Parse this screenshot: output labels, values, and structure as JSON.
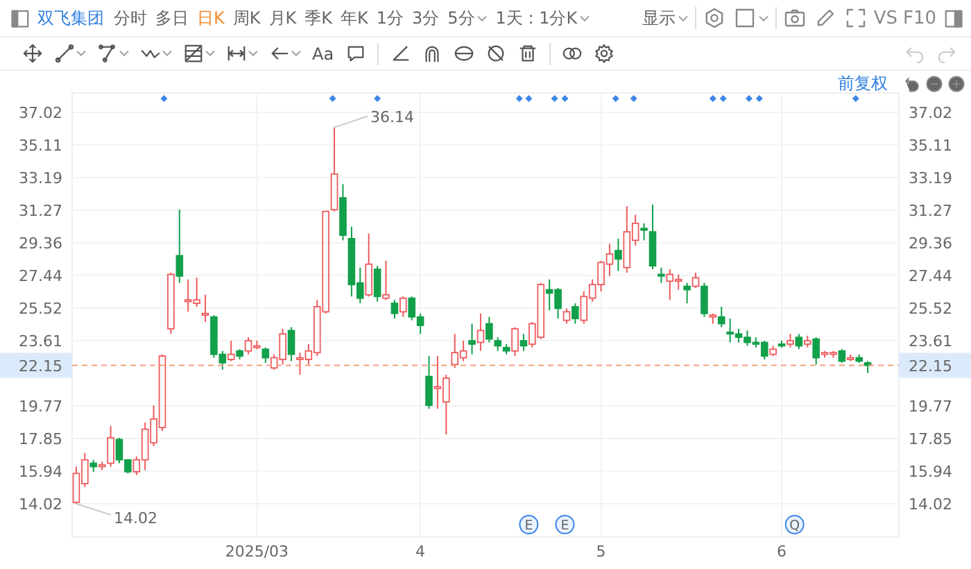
{
  "toolbar": {
    "stock_name": "双飞集团",
    "periods": [
      {
        "label": "分时",
        "selected": false,
        "dropdown": false
      },
      {
        "label": "多日",
        "selected": false,
        "dropdown": false
      },
      {
        "label": "日K",
        "selected": true,
        "dropdown": false
      },
      {
        "label": "周K",
        "selected": false,
        "dropdown": false
      },
      {
        "label": "月K",
        "selected": false,
        "dropdown": false
      },
      {
        "label": "季K",
        "selected": false,
        "dropdown": false
      },
      {
        "label": "年K",
        "selected": false,
        "dropdown": false
      },
      {
        "label": "1分",
        "selected": false,
        "dropdown": false
      },
      {
        "label": "3分",
        "selected": false,
        "dropdown": false
      },
      {
        "label": "5分",
        "selected": false,
        "dropdown": true
      }
    ],
    "interval_select": "1天 : 1分K",
    "display_menu": "显示",
    "compare": "VS",
    "f10": "F10"
  },
  "drawing_tools": [
    {
      "kind": "move",
      "dropdown": false
    },
    {
      "kind": "line",
      "dropdown": true
    },
    {
      "kind": "polyline",
      "dropdown": true
    },
    {
      "kind": "wave",
      "dropdown": true
    },
    {
      "kind": "fib",
      "dropdown": true
    },
    {
      "kind": "measure",
      "dropdown": true
    },
    {
      "kind": "arrow",
      "dropdown": true
    },
    {
      "kind": "text",
      "label": "Aa",
      "dropdown": false
    },
    {
      "kind": "comment",
      "dropdown": false
    },
    {
      "kind": "separator"
    },
    {
      "kind": "angle",
      "dropdown": false
    },
    {
      "kind": "magnet",
      "dropdown": false
    },
    {
      "kind": "eye",
      "dropdown": false
    },
    {
      "kind": "eye_off",
      "dropdown": false
    },
    {
      "kind": "trash",
      "dropdown": false
    },
    {
      "kind": "separator"
    },
    {
      "kind": "link",
      "dropdown": false
    },
    {
      "kind": "gear",
      "dropdown": false
    }
  ],
  "history": {
    "undo_disabled": true,
    "redo_disabled": true
  },
  "chart": {
    "adjust_mode": "前复权",
    "chart_data": {
      "type": "candlestick",
      "grid": true,
      "ylim": [
        12.06,
        38.16
      ],
      "categories": [
        null,
        null,
        null,
        null,
        null,
        null,
        null,
        null,
        null,
        null,
        null,
        null,
        null,
        null,
        null,
        null,
        null,
        null,
        null,
        null,
        null,
        "2025/03",
        null,
        null,
        null,
        null,
        null,
        null,
        null,
        null,
        null,
        null,
        null,
        null,
        null,
        null,
        null,
        null,
        null,
        null,
        "4",
        null,
        null,
        null,
        null,
        null,
        null,
        null,
        null,
        null,
        null,
        null,
        null,
        null,
        null,
        null,
        null,
        null,
        null,
        null,
        null,
        "5",
        null,
        null,
        null,
        null,
        null,
        null,
        null,
        null,
        null,
        null,
        null,
        null,
        null,
        null,
        null,
        null,
        null,
        null,
        null,
        null,
        "6",
        null,
        null,
        null,
        null,
        null,
        null,
        null,
        null,
        null,
        null
      ],
      "ohlc": [
        [
          14.1,
          16.2,
          14.02,
          15.8
        ],
        [
          15.2,
          17.0,
          15.0,
          16.6
        ],
        [
          16.4,
          16.6,
          15.9,
          16.2
        ],
        [
          16.2,
          16.5,
          16.0,
          16.3
        ],
        [
          16.4,
          18.6,
          16.2,
          17.9
        ],
        [
          17.8,
          17.9,
          16.4,
          16.6
        ],
        [
          16.6,
          16.6,
          15.8,
          15.9
        ],
        [
          15.9,
          16.8,
          15.7,
          16.6
        ],
        [
          16.6,
          18.8,
          16.0,
          18.4
        ],
        [
          17.6,
          19.8,
          17.4,
          19.0
        ],
        [
          18.5,
          22.8,
          18.3,
          22.7
        ],
        [
          24.3,
          27.6,
          24.0,
          27.5
        ],
        [
          28.6,
          31.3,
          27.0,
          27.4
        ],
        [
          26.0,
          27.2,
          25.3,
          26.0
        ],
        [
          25.8,
          27.3,
          25.6,
          26.0
        ],
        [
          25.2,
          26.3,
          24.7,
          25.2
        ],
        [
          25.0,
          25.1,
          22.6,
          22.8
        ],
        [
          22.8,
          23.0,
          21.9,
          22.3
        ],
        [
          22.5,
          23.6,
          22.4,
          22.8
        ],
        [
          23.0,
          23.1,
          22.5,
          22.7
        ],
        [
          23.0,
          23.8,
          22.8,
          23.6
        ],
        [
          23.3,
          23.6,
          23.1,
          23.3
        ],
        [
          23.1,
          23.2,
          22.3,
          22.6
        ],
        [
          22.0,
          22.8,
          21.9,
          22.6
        ],
        [
          22.5,
          24.3,
          22.2,
          24.0
        ],
        [
          24.2,
          24.4,
          22.4,
          22.8
        ],
        [
          22.6,
          22.9,
          21.6,
          22.6
        ],
        [
          22.5,
          23.4,
          22.2,
          23.0
        ],
        [
          22.9,
          26.0,
          22.7,
          25.6
        ],
        [
          25.3,
          31.2,
          25.2,
          31.2
        ],
        [
          31.3,
          36.14,
          31.2,
          33.4
        ],
        [
          32.0,
          32.8,
          29.5,
          29.8
        ],
        [
          29.6,
          30.3,
          26.2,
          26.9
        ],
        [
          27.0,
          27.9,
          25.8,
          26.1
        ],
        [
          26.3,
          29.9,
          26.2,
          28.1
        ],
        [
          27.8,
          28.0,
          25.9,
          26.2
        ],
        [
          26.1,
          28.3,
          26.0,
          26.3
        ],
        [
          25.8,
          26.0,
          24.9,
          25.2
        ],
        [
          25.3,
          26.2,
          25.0,
          26.1
        ],
        [
          26.1,
          26.2,
          24.8,
          25.0
        ],
        [
          25.0,
          25.2,
          24.0,
          24.5
        ],
        [
          21.5,
          22.7,
          19.6,
          19.8
        ],
        [
          20.8,
          22.7,
          19.6,
          20.9
        ],
        [
          20.0,
          21.6,
          18.1,
          21.4
        ],
        [
          22.2,
          24.0,
          22.0,
          22.9
        ],
        [
          22.6,
          23.6,
          22.4,
          23.0
        ],
        [
          23.6,
          24.6,
          22.8,
          23.4
        ],
        [
          23.5,
          25.2,
          23.0,
          24.2
        ],
        [
          24.6,
          25.0,
          23.5,
          23.7
        ],
        [
          23.6,
          23.8,
          23.0,
          23.3
        ],
        [
          23.2,
          23.4,
          22.8,
          23.0
        ],
        [
          23.0,
          24.4,
          22.7,
          24.3
        ],
        [
          23.6,
          24.0,
          23.0,
          23.3
        ],
        [
          23.4,
          24.7,
          23.2,
          24.6
        ],
        [
          23.8,
          27.0,
          23.7,
          26.9
        ],
        [
          26.6,
          27.2,
          25.4,
          26.4
        ],
        [
          26.6,
          26.7,
          24.9,
          25.5
        ],
        [
          24.8,
          25.5,
          24.6,
          25.3
        ],
        [
          25.6,
          25.8,
          24.6,
          24.9
        ],
        [
          24.8,
          26.5,
          24.6,
          26.2
        ],
        [
          26.1,
          27.2,
          25.9,
          26.9
        ],
        [
          26.9,
          28.3,
          26.5,
          28.2
        ],
        [
          28.1,
          29.3,
          27.4,
          28.7
        ],
        [
          28.9,
          29.6,
          27.7,
          28.4
        ],
        [
          27.9,
          31.5,
          27.6,
          30.0
        ],
        [
          29.5,
          31.0,
          29.2,
          30.5
        ],
        [
          30.2,
          30.5,
          29.5,
          30.1
        ],
        [
          30.0,
          31.6,
          27.8,
          28.0
        ],
        [
          27.5,
          27.9,
          27.0,
          27.4
        ],
        [
          27.1,
          27.8,
          26.0,
          27.5
        ],
        [
          27.1,
          27.5,
          26.6,
          27.2
        ],
        [
          26.8,
          27.0,
          25.8,
          26.6
        ],
        [
          26.8,
          27.6,
          26.7,
          27.3
        ],
        [
          26.8,
          27.0,
          25.0,
          25.2
        ],
        [
          25.0,
          25.2,
          24.6,
          25.1
        ],
        [
          25.0,
          25.6,
          24.4,
          24.6
        ],
        [
          24.1,
          24.9,
          23.5,
          24.0
        ],
        [
          24.0,
          24.3,
          23.5,
          23.8
        ],
        [
          23.8,
          24.2,
          23.3,
          23.5
        ],
        [
          23.5,
          23.8,
          23.2,
          23.4
        ],
        [
          23.5,
          23.6,
          22.5,
          22.7
        ],
        [
          22.8,
          23.3,
          22.7,
          23.1
        ],
        [
          23.4,
          23.6,
          23.2,
          23.3
        ],
        [
          23.4,
          24.0,
          23.2,
          23.6
        ],
        [
          23.8,
          24.0,
          23.1,
          23.3
        ],
        [
          23.4,
          23.9,
          23.2,
          23.6
        ],
        [
          23.7,
          23.8,
          22.2,
          22.6
        ],
        [
          22.8,
          23.0,
          22.6,
          22.9
        ],
        [
          22.8,
          23.0,
          22.6,
          22.9
        ],
        [
          23.0,
          23.1,
          22.3,
          22.4
        ],
        [
          22.5,
          22.8,
          22.4,
          22.6
        ],
        [
          22.6,
          22.8,
          22.3,
          22.4
        ],
        [
          22.3,
          22.4,
          21.7,
          22.15
        ]
      ],
      "ref_lines": [
        {
          "axis": "y",
          "value": 22.15,
          "label": "22.15",
          "color": "#f0a080"
        }
      ],
      "yticks": [
        {
          "value": 37.02,
          "label": "37.02"
        },
        {
          "value": 35.11,
          "label": "35.11"
        },
        {
          "value": 33.19,
          "label": "33.19"
        },
        {
          "value": 31.27,
          "label": "31.27"
        },
        {
          "value": 29.36,
          "label": "29.36"
        },
        {
          "value": 27.44,
          "label": "27.44"
        },
        {
          "value": 25.52,
          "label": "25.52"
        },
        {
          "value": 23.61,
          "label": "23.61"
        },
        {
          "value": 19.77,
          "label": "19.77"
        },
        {
          "value": 17.85,
          "label": "17.85"
        },
        {
          "value": 15.94,
          "label": "15.94"
        },
        {
          "value": 14.02,
          "label": "14.02"
        }
      ],
      "annotations": [
        "36.14",
        "14.02",
        "E",
        "E",
        "Q"
      ]
    }
  }
}
